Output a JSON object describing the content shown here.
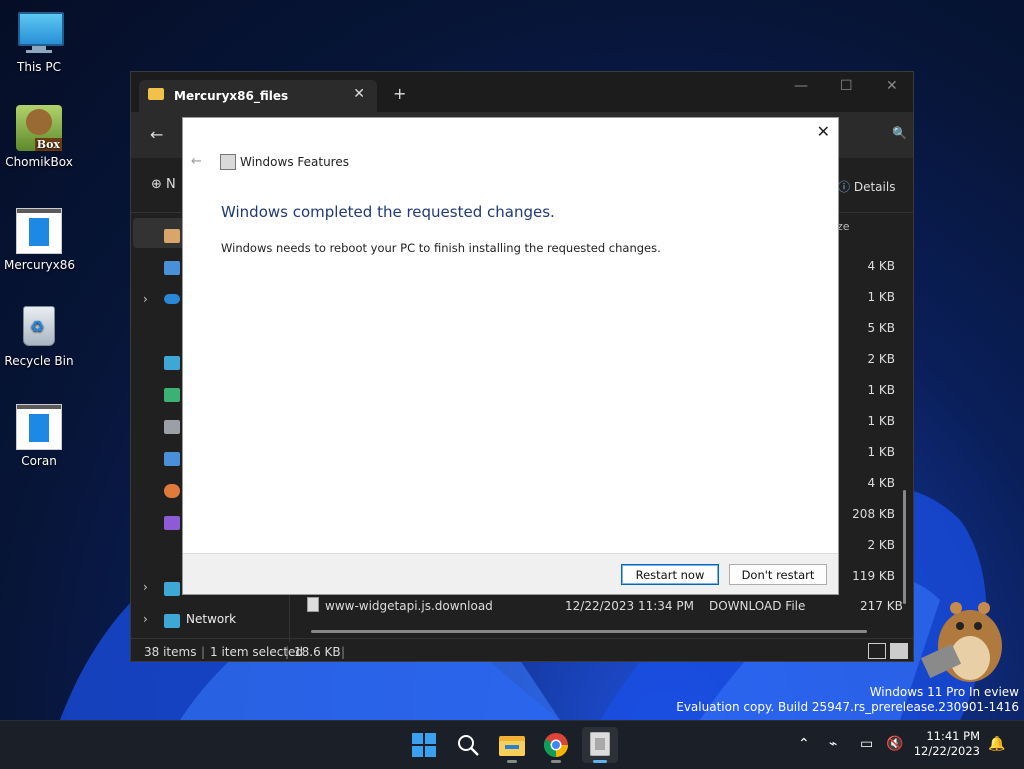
{
  "desktop": {
    "icons": [
      {
        "label": "This PC",
        "icon": "monitor-icon"
      },
      {
        "label": "ChomikBox",
        "icon": "chomikbox-icon",
        "badge": "Box"
      },
      {
        "label": "Mercuryx86",
        "icon": "app-window-icon"
      },
      {
        "label": "Recycle Bin",
        "icon": "recycle-bin-icon"
      },
      {
        "label": "Coran",
        "icon": "app-window-icon"
      }
    ]
  },
  "explorer": {
    "tab_title": "Mercuryx86_files",
    "new_prefix": "N",
    "details_label": "Details",
    "size_header": "ze",
    "sizes": [
      "4 KB",
      "1 KB",
      "5 KB",
      "2 KB",
      "1 KB",
      "1 KB",
      "1 KB",
      "4 KB",
      "208 KB",
      "2 KB",
      "119 KB"
    ],
    "nav_network": "Network",
    "file_row": {
      "name": "www-widgetapi.js.download",
      "date": "12/22/2023 11:34 PM",
      "type": "DOWNLOAD File",
      "size": "217 KB"
    },
    "status": {
      "count": "38 items",
      "selected": "1 item selected",
      "size": "18.6 KB"
    }
  },
  "dialog": {
    "app_title": "Windows Features",
    "heading": "Windows completed the requested changes.",
    "body": "Windows needs to reboot your PC to finish installing the requested changes.",
    "restart_label": "Restart now",
    "dont_restart_label": "Don't restart"
  },
  "watermark": {
    "line1": "Windows 11 Pro In   eview",
    "line2": "Evaluation copy. Build 25947.rs_prerelease.230901-1416"
  },
  "taskbar": {
    "apps": [
      "start-icon",
      "search-icon",
      "file-explorer-icon",
      "chrome-icon",
      "windows-features-icon"
    ],
    "time": "11:41 PM",
    "date": "12/22/2023"
  },
  "colors": {
    "accent": "#0067c0",
    "heading": "#1e3a78"
  }
}
